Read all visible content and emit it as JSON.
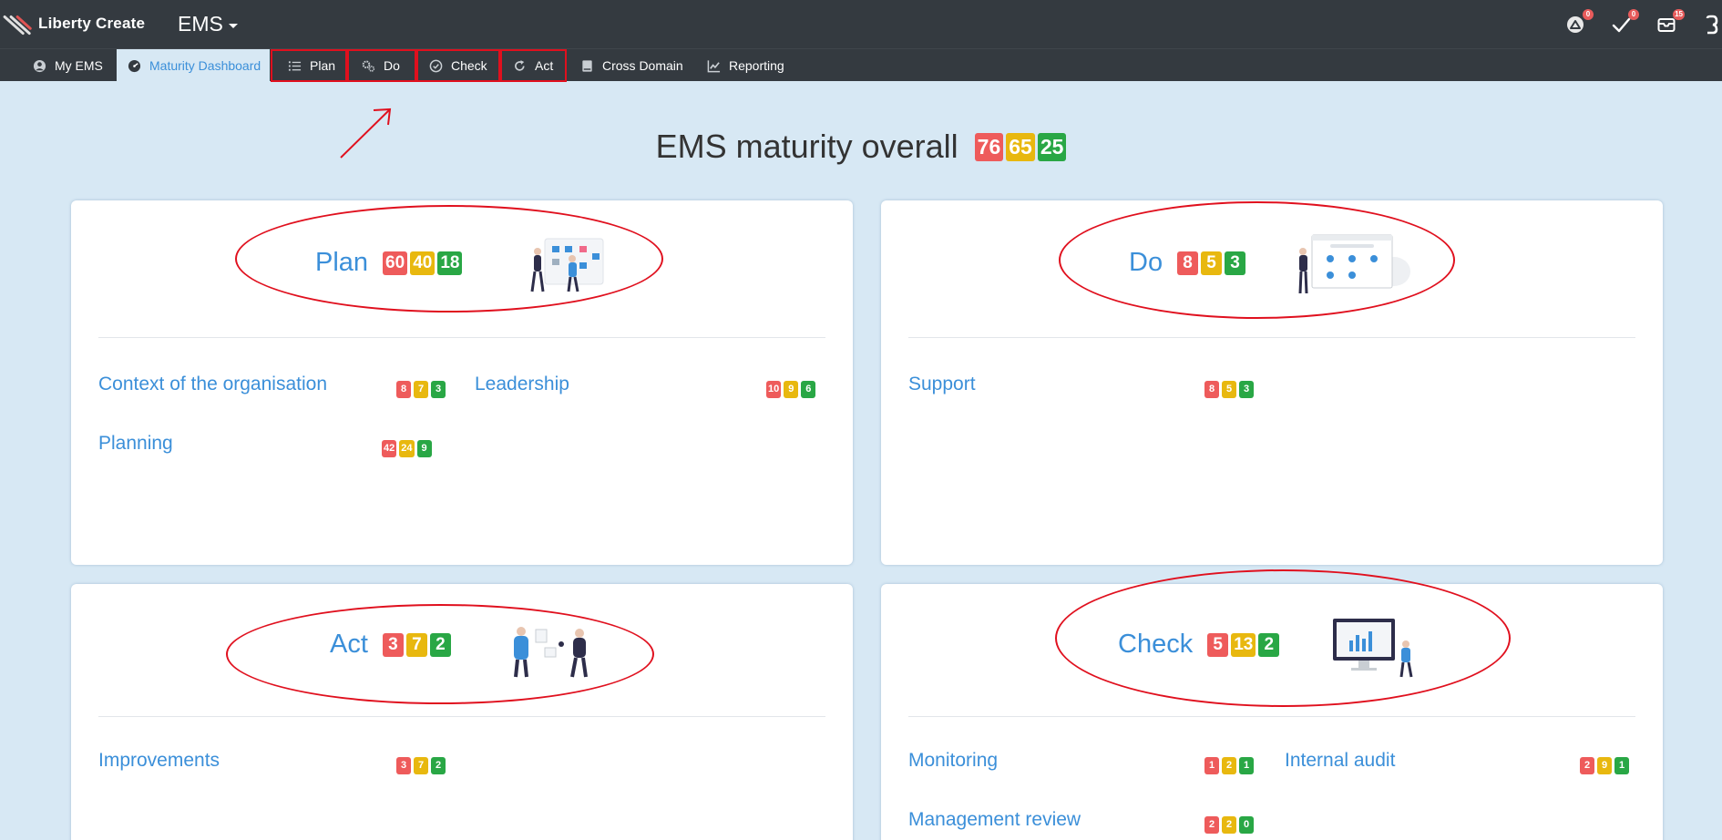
{
  "header": {
    "brand": "Liberty Create",
    "app_switcher": "EMS",
    "notifications": [
      {
        "icon": "alert-icon",
        "count": "0"
      },
      {
        "icon": "check-icon",
        "count": "0"
      },
      {
        "icon": "inbox-icon",
        "count": "15"
      }
    ],
    "user_icon": "user-icon"
  },
  "nav": {
    "items": [
      {
        "label": "My EMS",
        "icon": "user-circle-icon"
      },
      {
        "label": "Maturity Dashboard",
        "icon": "dashboard-icon",
        "active": true
      },
      {
        "label": "Plan",
        "icon": "list-icon"
      },
      {
        "label": "Do",
        "icon": "gears-icon"
      },
      {
        "label": "Check",
        "icon": "check-circle-icon"
      },
      {
        "label": "Act",
        "icon": "redo-icon"
      },
      {
        "label": "Cross Domain",
        "icon": "book-icon"
      },
      {
        "label": "Reporting",
        "icon": "chart-icon"
      }
    ]
  },
  "overall": {
    "title": "EMS maturity overall",
    "badges": {
      "red": "76",
      "yellow": "65",
      "green": "25"
    }
  },
  "colors": {
    "red": "#ee5b5b",
    "yellow": "#e8b80f",
    "green": "#29a745",
    "link": "#3b8fd9",
    "annotation": "#e0101e"
  },
  "cards": {
    "plan": {
      "title": "Plan",
      "badges": {
        "red": "60",
        "yellow": "40",
        "green": "18"
      },
      "items": [
        {
          "label": "Context of the organisation",
          "red": "8",
          "yellow": "7",
          "green": "3"
        },
        {
          "label": "Leadership",
          "red": "10",
          "yellow": "9",
          "green": "6"
        },
        {
          "label": "Planning",
          "red": "42",
          "yellow": "24",
          "green": "9"
        }
      ]
    },
    "do": {
      "title": "Do",
      "badges": {
        "red": "8",
        "yellow": "5",
        "green": "3"
      },
      "items": [
        {
          "label": "Support",
          "red": "8",
          "yellow": "5",
          "green": "3"
        }
      ]
    },
    "act": {
      "title": "Act",
      "badges": {
        "red": "3",
        "yellow": "7",
        "green": "2"
      },
      "items": [
        {
          "label": "Improvements",
          "red": "3",
          "yellow": "7",
          "green": "2"
        }
      ]
    },
    "check": {
      "title": "Check",
      "badges": {
        "red": "5",
        "yellow": "13",
        "green": "2"
      },
      "items": [
        {
          "label": "Monitoring",
          "red": "1",
          "yellow": "2",
          "green": "1"
        },
        {
          "label": "Internal audit",
          "red": "2",
          "yellow": "9",
          "green": "1"
        },
        {
          "label": "Management review",
          "red": "2",
          "yellow": "2",
          "green": "0"
        }
      ]
    }
  }
}
